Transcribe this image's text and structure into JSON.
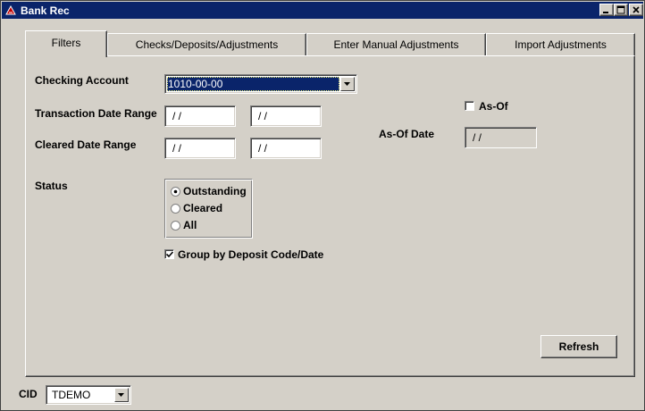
{
  "window": {
    "title": "Bank Rec",
    "controls": {
      "minimize_icon": "minimize-icon",
      "maximize_icon": "maximize-icon",
      "close_icon": "close-icon"
    }
  },
  "tabs": [
    {
      "label": "Filters",
      "active": true
    },
    {
      "label": "Checks/Deposits/Adjustments",
      "active": false
    },
    {
      "label": "Enter Manual Adjustments",
      "active": false
    },
    {
      "label": "Import Adjustments",
      "active": false
    }
  ],
  "filters": {
    "checking_account": {
      "label": "Checking Account",
      "value": "1010-00-00"
    },
    "transaction_date_range": {
      "label": "Transaction Date Range",
      "from": " / /",
      "to": " / /"
    },
    "cleared_date_range": {
      "label": "Cleared Date Range",
      "from": " / /",
      "to": " / /"
    },
    "as_of": {
      "label": "As-Of",
      "checked": false
    },
    "as_of_date": {
      "label": "As-Of Date",
      "value": " / /"
    },
    "status": {
      "label": "Status",
      "options": [
        "Outstanding",
        "Cleared",
        "All"
      ],
      "selected": "Outstanding"
    },
    "group_by_deposit": {
      "label": "Group by Deposit Code/Date",
      "checked": true
    }
  },
  "refresh_button": "Refresh",
  "cid": {
    "label": "CID",
    "value": "TDEMO"
  },
  "colors": {
    "titlebar": "#0a246a",
    "face": "#d4d0c8",
    "selection": "#0a246a"
  }
}
